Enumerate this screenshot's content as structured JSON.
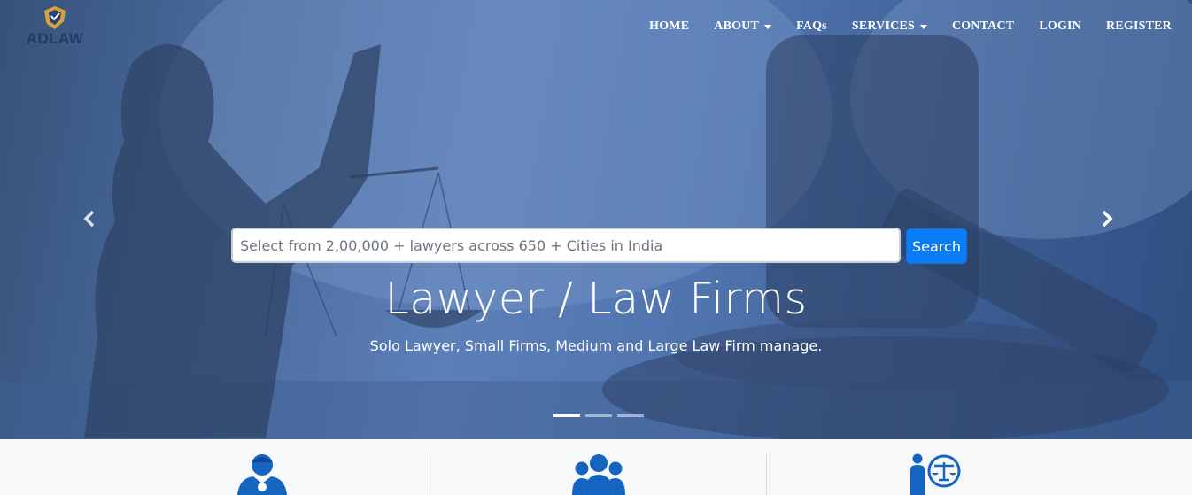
{
  "brand": {
    "name": "ADLAW"
  },
  "nav": {
    "items": [
      {
        "label": "HOME",
        "dropdown": false
      },
      {
        "label": "ABOUT",
        "dropdown": true
      },
      {
        "label": "FAQs",
        "dropdown": false
      },
      {
        "label": "SERVICES",
        "dropdown": true
      },
      {
        "label": "CONTACT",
        "dropdown": false
      },
      {
        "label": "LOGIN",
        "dropdown": false
      },
      {
        "label": "REGISTER",
        "dropdown": false
      }
    ]
  },
  "hero": {
    "search_placeholder": "Select from 2,00,000 + lawyers across 650 + Cities in India",
    "search_value": "",
    "search_button": "Search",
    "title": "Lawyer / Law Firms",
    "subtitle": "Solo Lawyer, Small Firms, Medium and Large Law Firm manage.",
    "slides": 3,
    "active_slide": 1
  },
  "icons": {
    "prev": "chevron-left-icon",
    "next": "chevron-right-icon",
    "features": [
      "lawyer-user-icon",
      "group-users-icon",
      "lawyer-scales-icon"
    ]
  },
  "colors": {
    "primary": "#0a7cf5",
    "icon_blue": "#1565c0",
    "hero_tint": "#4a6ea8"
  }
}
